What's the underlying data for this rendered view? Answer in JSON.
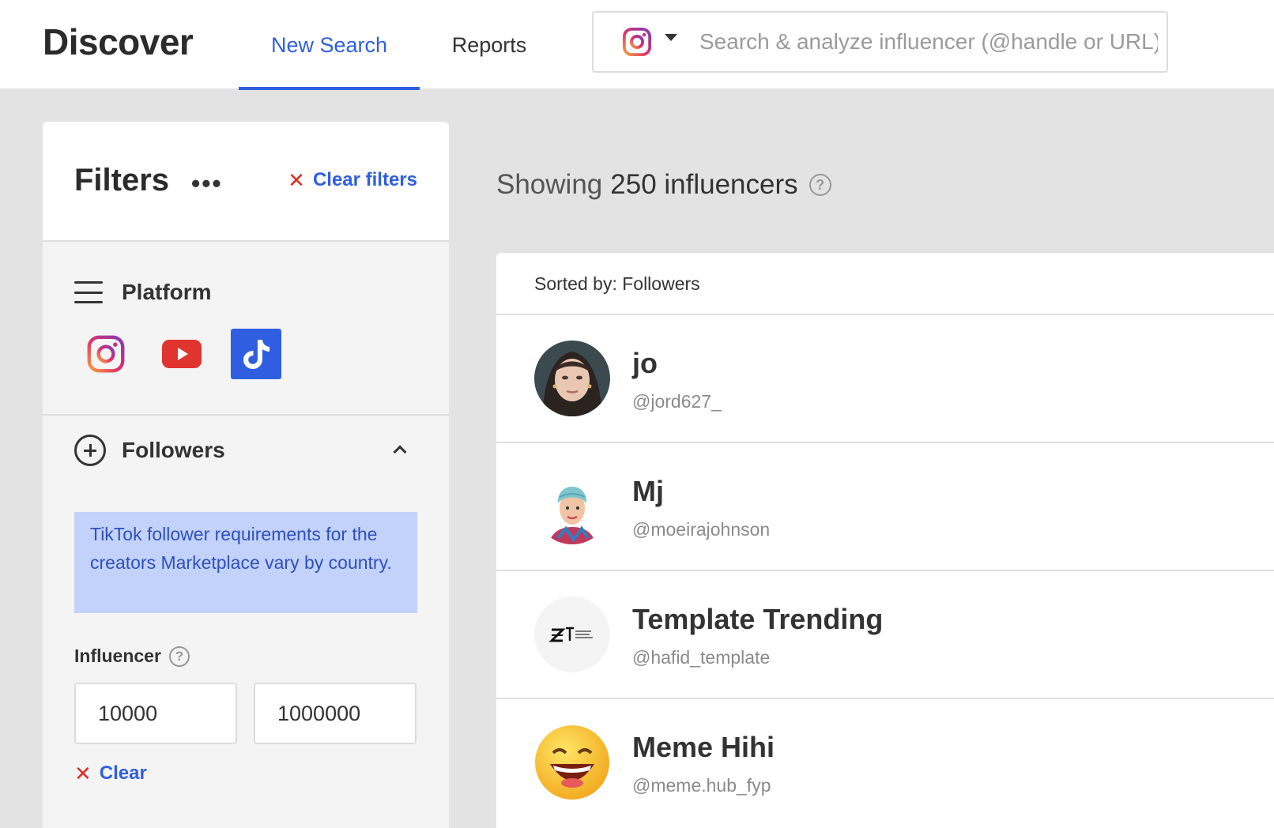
{
  "header": {
    "brand": "Discover",
    "tabs": [
      {
        "label": "New Search",
        "active": true
      },
      {
        "label": "Reports",
        "active": false
      }
    ],
    "search": {
      "platform_icon": "instagram-icon",
      "placeholder": "Search & analyze influencer (@handle or URL)",
      "value": ""
    }
  },
  "filters": {
    "title": "Filters",
    "more_label": "•••",
    "clear_filters_label": "Clear filters",
    "platform": {
      "title": "Platform",
      "options": [
        {
          "name": "instagram",
          "icon": "instagram-icon",
          "selected": false
        },
        {
          "name": "youtube",
          "icon": "youtube-icon",
          "selected": false
        },
        {
          "name": "tiktok",
          "icon": "tiktok-icon",
          "selected": true
        }
      ]
    },
    "followers": {
      "title": "Followers",
      "notice": "TikTok follower requirements for the creators Marketplace vary by country.",
      "influencer_label": "Influencer",
      "help_glyph": "?",
      "min": "10000",
      "max": "1000000",
      "clear_label": "Clear"
    }
  },
  "results": {
    "showing_prefix": "Showing",
    "showing_count": "250 influencers",
    "sorted_by": "Sorted by: Followers",
    "items": [
      {
        "name": "jo",
        "handle": "@jord627_",
        "avatar": "photo-woman"
      },
      {
        "name": "Mj",
        "handle": "@moeirajohnson",
        "avatar": "cartoon-woman"
      },
      {
        "name": "Template Trending",
        "handle": "@hafid_template",
        "avatar": "template-logo"
      },
      {
        "name": "Meme Hihi",
        "handle": "@meme.hub_fyp",
        "avatar": "laughing-emoji"
      }
    ]
  },
  "colors": {
    "accent": "#2f5ee0",
    "notice_bg": "#c2d2fb",
    "clear_x": "#d93025",
    "page_bg": "#e3e3e3"
  }
}
